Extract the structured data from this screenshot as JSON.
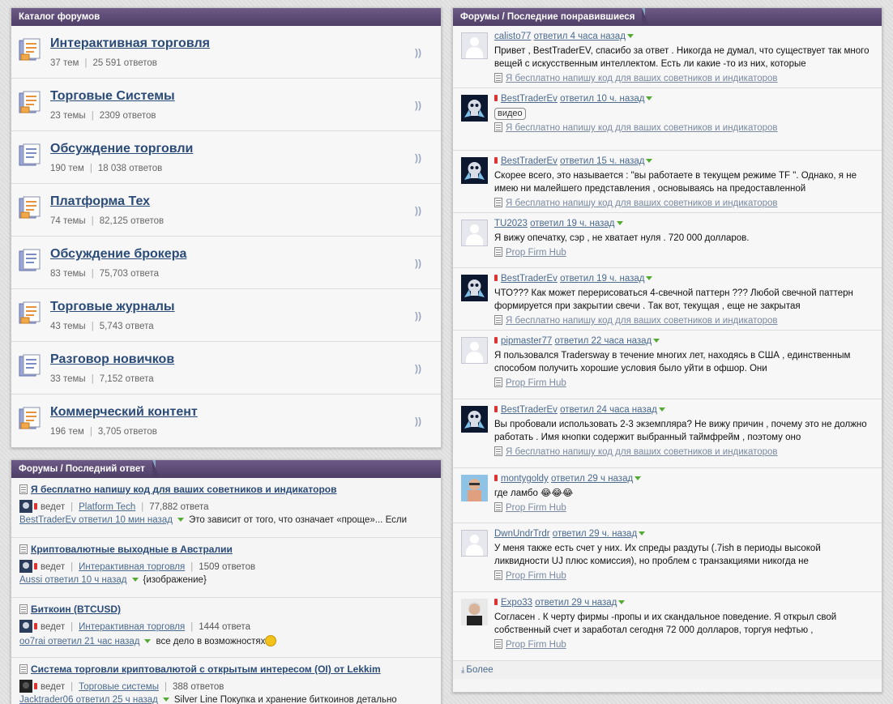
{
  "catalog": {
    "title": "Каталог форумов",
    "items": [
      {
        "title": "Интерактивная торговля",
        "topics": "37 тем",
        "replies": "25 591 ответов",
        "icon": "forum-hot-icon"
      },
      {
        "title": "Торговые Системы",
        "topics": "23 темы",
        "replies": "2309 ответов",
        "icon": "forum-hot-icon"
      },
      {
        "title": "Обсуждение торговли",
        "topics": "190 тем",
        "replies": "18 038 ответов",
        "icon": "forum-icon"
      },
      {
        "title": "Платформа Тех",
        "topics": "74 темы",
        "replies": "82,125 ответов",
        "icon": "forum-hot-icon"
      },
      {
        "title": "Обсуждение брокера",
        "topics": "83 темы",
        "replies": "75,703 ответа",
        "icon": "forum-icon"
      },
      {
        "title": "Торговые журналы",
        "topics": "43 темы",
        "replies": "5,743 ответа",
        "icon": "forum-hot-icon"
      },
      {
        "title": "Разговор новичков",
        "topics": "33 темы",
        "replies": "7,152 ответа",
        "icon": "forum-icon"
      },
      {
        "title": "Коммерческий контент",
        "topics": "196 тем",
        "replies": "3,705 ответов",
        "icon": "forum-hot-icon"
      }
    ]
  },
  "lastreply": {
    "title": "Форумы / Последний ответ",
    "items": [
      {
        "title": "Я бесплатно напишу код для ваших советников и индикаторов",
        "leads": "ведет",
        "forum": "Platform Tech",
        "replies": "77,882 ответа",
        "who": "BestTraderEv ответил 10 мин назад",
        "snippet": "Это зависит от того, что означает «проще»... Если"
      },
      {
        "title": "Криптовалютные выходные в Австралии",
        "leads": "ведет",
        "forum": "Интерактивная торговля",
        "replies": "1509 ответов",
        "who": "Aussi ответил 10 ч назад",
        "snippet": "{изображение}"
      },
      {
        "title": "Биткоин (BTCUSD)",
        "leads": "ведет",
        "forum": "Интерактивная торговля",
        "replies": "1444 ответа",
        "who": "oo7rai ответил 21 час назад",
        "snippet": "все дело в возможностях"
      },
      {
        "title": "Система торговли криптовалютой с открытым интересом (OI) от Lekkim",
        "leads": "ведет",
        "forum": "Торговые системы",
        "replies": "388 ответов",
        "who": "Jacktrader06 ответил 25 ч назад",
        "snippet": "Silver Line Покупка и хранение биткоинов детально"
      }
    ]
  },
  "liked": {
    "title": "Форумы / Последние понравившиеся",
    "more": "Более",
    "items": [
      {
        "user": "calisto77",
        "action": "ответил 4 часа назад",
        "flag": false,
        "avatar": "default",
        "text": "Привет , BestTraderEV, спасибо за ответ . Никогда не думал, что существует так много вещей с искусственным интеллектом. Есть ли какие -то из них, которые",
        "thread": "Я бесплатно напишу код для ваших советников и индикаторов"
      },
      {
        "user": "BestTraderEv",
        "action": "ответил 10 ч. назад",
        "flag": true,
        "avatar": "skull",
        "text": "",
        "badge": "видео",
        "thread": "Я бесплатно напишу код для ваших советников и индикаторов"
      },
      {
        "user": "BestTraderEv",
        "action": "ответил 15 ч. назад",
        "flag": true,
        "avatar": "skull",
        "text": "Скорее всего, это называется : \"вы работаете в текущем режиме TF \". Однако, я не имею ни малейшего представления , основываясь на предоставленной",
        "thread": "Я бесплатно напишу код для ваших советников и индикаторов"
      },
      {
        "user": "TU2023",
        "action": "ответил 19 ч. назад",
        "flag": false,
        "avatar": "default",
        "text": "Я вижу опечатку, сэр , не хватает нуля . 720 000 долларов.",
        "thread": "Prop Firm Hub"
      },
      {
        "user": "BestTraderEv",
        "action": "ответил 19 ч. назад",
        "flag": true,
        "avatar": "skull",
        "text": "ЧТО??? Как может перерисоваться 4-свечной паттерн ??? Любой свечной паттерн формируется при закрытии свечи . Так вот, текущая , еще не закрытая",
        "thread": "Я бесплатно напишу код для ваших советников и индикаторов"
      },
      {
        "user": "pipmaster77",
        "action": "ответил 22 часа назад",
        "flag": true,
        "avatar": "default",
        "text": "Я пользовался Tradersway в течение многих лет, находясь в США , единственным способом получить хорошие условия было уйти в офшор. Они",
        "thread": "Prop Firm Hub"
      },
      {
        "user": "BestTraderEv",
        "action": "ответил 24 часа назад",
        "flag": true,
        "avatar": "skull",
        "text": "Вы пробовали использовать 2-3 экземпляра? Не вижу причин , почему это не должно работать . Имя кнопки содержит выбранный таймфрейм , поэтому оно",
        "thread": "Я бесплатно напишу код для ваших советников и индикаторов"
      },
      {
        "user": "montygoldy",
        "action": "ответил 29 ч назад",
        "flag": true,
        "avatar": "photo",
        "text": "где ламбо 😂😂😂",
        "thread": "Prop Firm Hub"
      },
      {
        "user": "DwnUndrTrdr",
        "action": "ответил 29 ч. назад",
        "flag": false,
        "avatar": "default",
        "text": "У меня также есть счет у них. Их спреды раздуты (.7ish в периоды высокой ликвидности UJ плюс комиссия), но проблем с транзакциями никогда не",
        "thread": "Prop Firm Hub"
      },
      {
        "user": "Expo33",
        "action": "ответил 29 ч назад",
        "flag": true,
        "avatar": "photo2",
        "text": "Согласен . К черту фирмы -пропы и их скандальное поведение. Я открыл свой собственный счет и заработал сегодня 72 000 долларов, торгуя нефтью ,",
        "thread": "Prop Firm Hub"
      }
    ]
  }
}
